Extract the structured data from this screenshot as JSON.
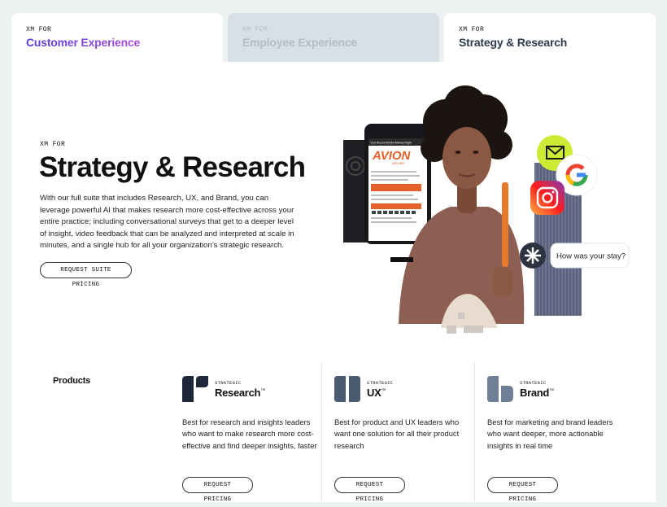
{
  "tabs": [
    {
      "eyebrow": "XM FOR",
      "title": "Customer Experience"
    },
    {
      "eyebrow": "XM FOR",
      "title": "Employee Experience"
    },
    {
      "eyebrow": "XM FOR",
      "title": "Strategy & Research"
    }
  ],
  "hero": {
    "eyebrow": "XM FOR",
    "title": "Strategy & Research",
    "body": "With our full suite that includes Research, UX, and Brand, you can leverage powerful AI that makes research more cost-effective across your entire practice; including conversational surveys that get to a deeper level of insight, video feedback that can be analyzed and interpreted at scale in minutes, and a single hub for all your organization’s strategic research.",
    "button_label": "REQUEST SUITE PRICING"
  },
  "art": {
    "phone_header": "Your Recent AVION Airlines Flight",
    "phone_brand": "AVION",
    "phone_brand_sub": "AIRLINES",
    "chat_bubble": "How was your stay?"
  },
  "products": {
    "label": "Products",
    "items": [
      {
        "eyebrow": "STRATEGIC",
        "name": "Research",
        "tm": "™",
        "description": "Best for research and insights leaders who want to make research more cost- effective and find deeper insights, faster",
        "button_label": "REQUEST PRICING"
      },
      {
        "eyebrow": "STRATEGIC",
        "name": "UX",
        "tm": "™",
        "description": "Best for product and UX leaders who want one solution for all their product research",
        "button_label": "REQUEST PRICING"
      },
      {
        "eyebrow": "STRATEGIC",
        "name": "Brand",
        "tm": "™",
        "description": "Best for marketing and brand leaders who want deeper, more actionable insights in real time",
        "button_label": "REQUEST PRICING"
      }
    ]
  },
  "colors": {
    "accent_purple": "#5a3be0",
    "accent_pink": "#e05ad0",
    "logo_navy": "#1e2838",
    "logo_slate": "#4a5a70",
    "logo_steel": "#6f7f96"
  }
}
